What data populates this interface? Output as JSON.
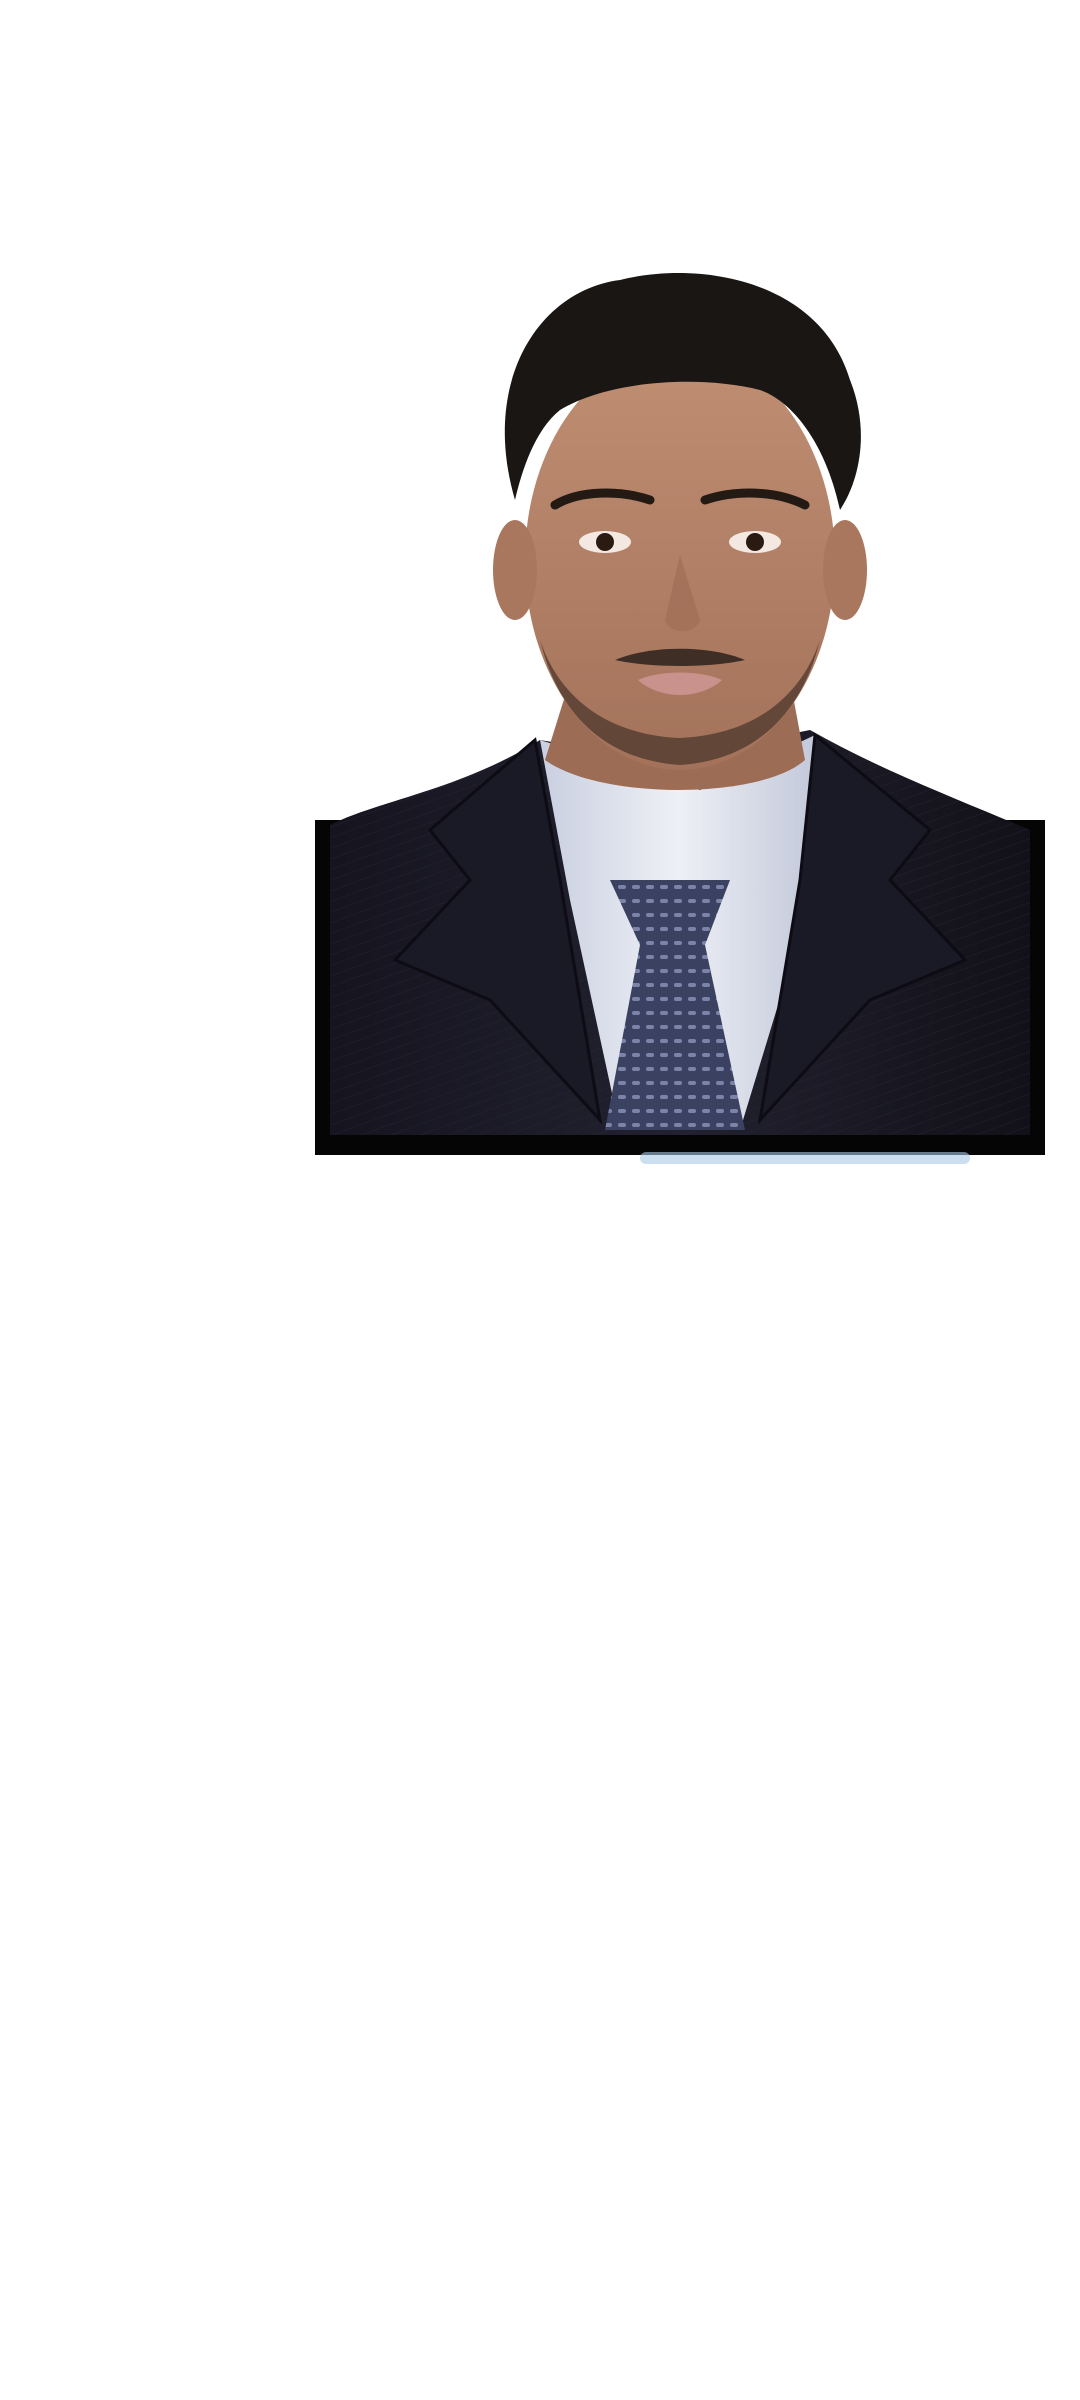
{
  "image": {
    "subject": "portrait-photo",
    "colors": {
      "background": "#ffffff",
      "suit": "#1c1b2a",
      "shirt": "#dfe3ee",
      "tie": "#3e4461",
      "hair": "#1a1614",
      "skin": "#b9876a",
      "frame_border": "#050505"
    }
  }
}
